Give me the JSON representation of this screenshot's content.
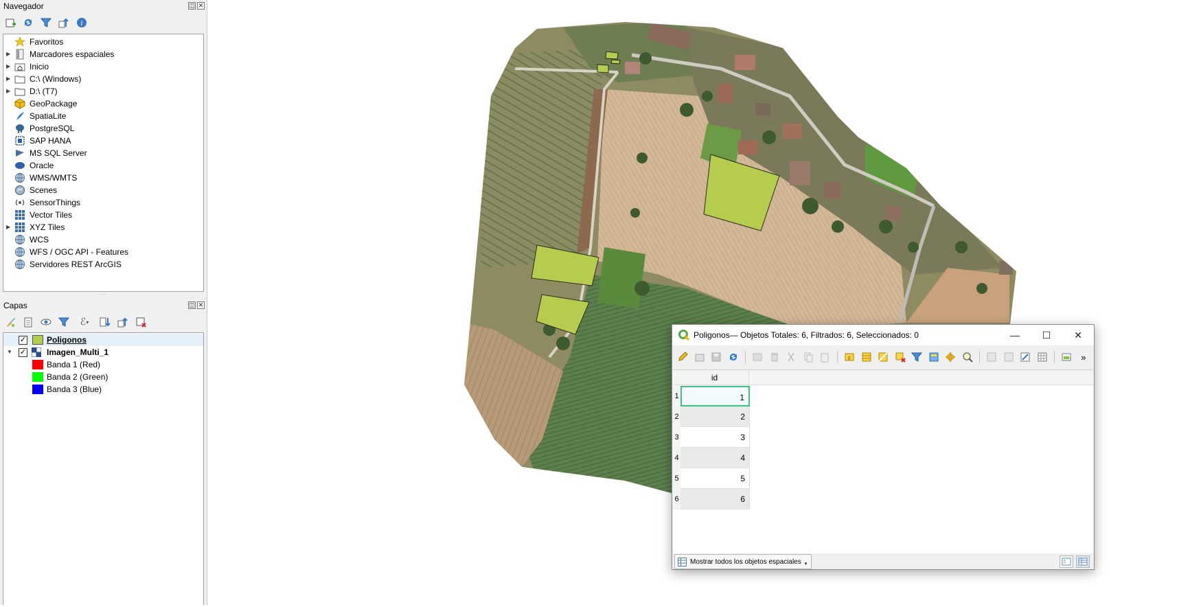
{
  "browser_panel": {
    "title": "Navegador",
    "items": [
      {
        "label": "Favoritos",
        "icon": "star-icon",
        "expandable": false
      },
      {
        "label": "Marcadores espaciales",
        "icon": "bookmark-icon",
        "expandable": true
      },
      {
        "label": "Inicio",
        "icon": "home-folder-icon",
        "expandable": true
      },
      {
        "label": "C:\\ (Windows)",
        "icon": "folder-icon",
        "expandable": true
      },
      {
        "label": "D:\\ (T7)",
        "icon": "folder-icon",
        "expandable": true
      },
      {
        "label": "GeoPackage",
        "icon": "geopackage-icon",
        "expandable": false
      },
      {
        "label": "SpatiaLite",
        "icon": "spatialite-icon",
        "expandable": false
      },
      {
        "label": "PostgreSQL",
        "icon": "postgresql-icon",
        "expandable": false
      },
      {
        "label": "SAP HANA",
        "icon": "sap-hana-icon",
        "expandable": false
      },
      {
        "label": "MS SQL Server",
        "icon": "mssql-icon",
        "expandable": false
      },
      {
        "label": "Oracle",
        "icon": "oracle-icon",
        "expandable": false
      },
      {
        "label": "WMS/WMTS",
        "icon": "globe-icon",
        "expandable": false
      },
      {
        "label": "Scenes",
        "icon": "scenes-icon",
        "expandable": false
      },
      {
        "label": "SensorThings",
        "icon": "sensor-icon",
        "expandable": false
      },
      {
        "label": "Vector Tiles",
        "icon": "grid-icon",
        "expandable": false
      },
      {
        "label": "XYZ Tiles",
        "icon": "grid-icon",
        "expandable": true
      },
      {
        "label": "WCS",
        "icon": "globe-icon",
        "expandable": false
      },
      {
        "label": "WFS / OGC API - Features",
        "icon": "globe-icon",
        "expandable": false
      },
      {
        "label": "Servidores REST ArcGIS",
        "icon": "globe-icon",
        "expandable": false
      }
    ]
  },
  "layers_panel": {
    "title": "Capas",
    "layers": [
      {
        "label": "Poligonos",
        "checked": true,
        "swatch": "#b5cc4e",
        "selected": true
      },
      {
        "label": "Imagen_Multi_1",
        "checked": true,
        "raster": true,
        "expanded": true,
        "bands": [
          {
            "label": "Banda 1 (Red)",
            "color": "#ff0000"
          },
          {
            "label": "Banda 2 (Green)",
            "color": "#00ff00"
          },
          {
            "label": "Banda 3 (Blue)",
            "color": "#0000ff"
          }
        ]
      }
    ]
  },
  "attribute_table": {
    "title": "Poligonos— Objetos Totales: 6, Filtrados: 6, Seleccionados: 0",
    "column": "id",
    "rows": [
      {
        "num": "1",
        "id": "1"
      },
      {
        "num": "2",
        "id": "2"
      },
      {
        "num": "3",
        "id": "3"
      },
      {
        "num": "4",
        "id": "4"
      },
      {
        "num": "5",
        "id": "5"
      },
      {
        "num": "6",
        "id": "6"
      }
    ],
    "show_all_label": "Mostrar todos los objetos espaciales",
    "more_label": "»"
  },
  "colors": {
    "polygon_fill": "#b5cc4e",
    "polygon_stroke": "#2a2a1a",
    "selection_border": "#3ac47d"
  }
}
